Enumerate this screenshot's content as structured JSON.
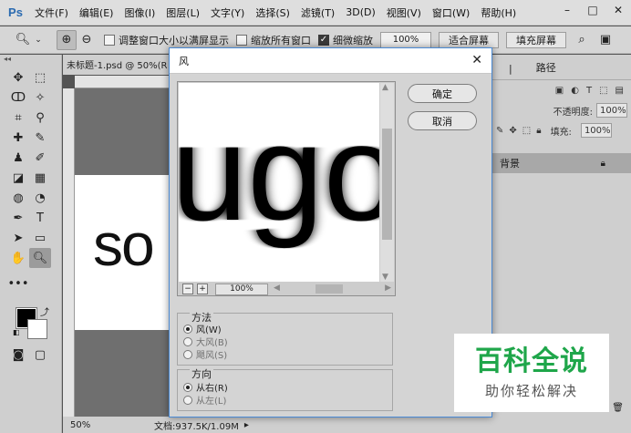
{
  "app": {
    "logo": "Ps"
  },
  "menu": [
    "文件(F)",
    "编辑(E)",
    "图像(I)",
    "图层(L)",
    "文字(Y)",
    "选择(S)",
    "滤镜(T)",
    "3D(D)",
    "视图(V)",
    "窗口(W)",
    "帮助(H)"
  ],
  "options": {
    "resize_windows": "调整窗口大小以满屏显示",
    "zoom_all_windows": "缩放所有窗口",
    "scrubby_zoom": "细微缩放",
    "zoom_value": "100%",
    "fit_screen": "适合屏幕",
    "fill_screen": "填充屏幕"
  },
  "document": {
    "tab": "未标题-1.psd @ 50%(R",
    "canvas_text": "so",
    "status_zoom": "50%",
    "status_doc": "文档:937.5K/1.09M"
  },
  "panels": {
    "tab_paths": "路径",
    "opacity_label": "不透明度:",
    "opacity_value": "100%",
    "fill_label": "填充:",
    "fill_value": "100%",
    "layer_name": "背景"
  },
  "dialog": {
    "title": "风",
    "ok": "确定",
    "cancel": "取消",
    "preview_text": "ugo",
    "preview_zoom": "100%",
    "method_title": "方法",
    "method_options": [
      "风(W)",
      "大风(B)",
      "飓风(S)"
    ],
    "direction_title": "方向",
    "direction_options": [
      "从右(R)",
      "从左(L)"
    ]
  },
  "watermark": {
    "title": "百科全说",
    "subtitle": "助你轻松解决"
  }
}
